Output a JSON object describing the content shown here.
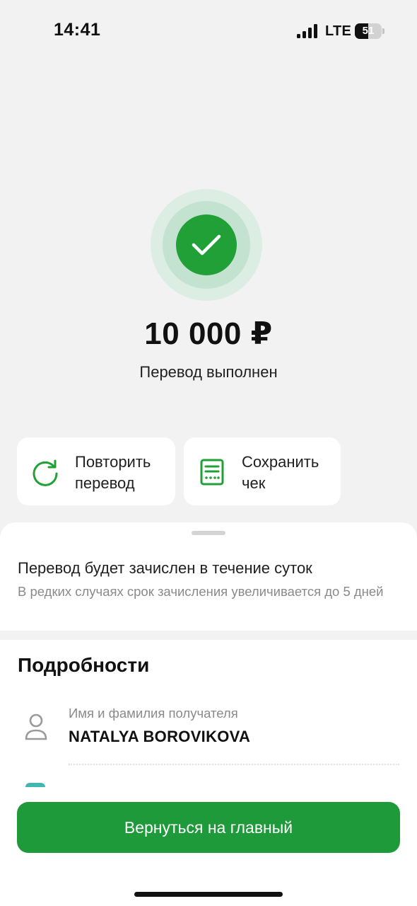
{
  "status_bar": {
    "time": "14:41",
    "network": "LTE",
    "battery": "51",
    "battery_level": 0.51,
    "signal_bars": 4
  },
  "result": {
    "amount": "10 000 ₽",
    "status": "Перевод выполнен",
    "icon": "checkmark-icon",
    "accent_color": "#21a038"
  },
  "actions": [
    {
      "label": "Повторить перевод",
      "icon": "repeat-icon"
    },
    {
      "label": "Сохранить чек",
      "icon": "receipt-icon"
    }
  ],
  "notice": {
    "title": "Перевод будет зачислен в течение суток",
    "subtitle": "В редких случаях срок зачисления увеличивается до 5 дней"
  },
  "details": {
    "title": "Подробности",
    "recipient": {
      "label": "Имя и фамилия получателя",
      "value": "NATALYA BOROVIKOVA",
      "icon": "person-icon"
    }
  },
  "primary_button": {
    "label": "Вернуться на главный",
    "color": "#1f9a3a"
  }
}
